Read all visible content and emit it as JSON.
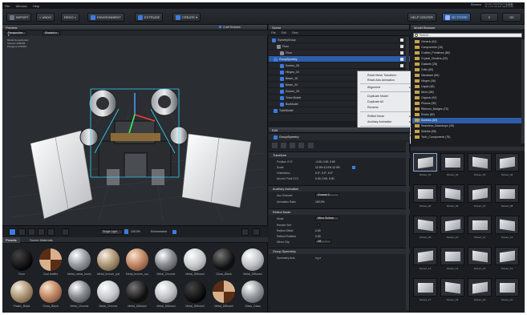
{
  "menu": [
    "File",
    "Window",
    "Help"
  ],
  "titleinfo": [
    "Quattro ENGINE/V11 2021",
    "11.1.0.0 US-EN 64bit-Vista",
    "Element",
    "1:1:5"
  ],
  "toolbar": {
    "import": "IMPORT",
    "undo": "< UNDO",
    "redo": "REDO >",
    "environment": "ENVIRONMENT",
    "extrude": "EXTRUDE",
    "create": "CREATE",
    "help": "HELP CENTER",
    "store": "3D STORE",
    "x_label": "X",
    "ok": "OK"
  },
  "viewport": {
    "title": "Preview",
    "craft": "Craft Textures",
    "view_select": "Perspective",
    "shade_select": "Shaded",
    "stats": [
      "Model  GroupSyntax",
      "Vertices  168/346",
      "Polygons  274/662"
    ],
    "light": "Single Light",
    "zoom": "100.0%",
    "env": "Environment"
  },
  "presets": {
    "tabs": [
      "Presets",
      "Scene Materials"
    ],
    "row1": [
      "Floor",
      "Cool leaftex",
      "Metal_metal_brush",
      "Metal_bronze_pat",
      "Metal_bronze_rou",
      "Metal_Chrome",
      "Metal_Diffused",
      "Gloss_Black",
      "Metal_Diffused"
    ],
    "row2": [
      "Plastic_Black",
      "Gloss_Black",
      "Metal_Chrome",
      "Metal_Chrome",
      "Metal_Diffused",
      "Metal_Diffused",
      "Metal_Diffused",
      "Metal_Diffused",
      "Glass_Glass"
    ]
  },
  "scene": {
    "title": "Scene",
    "sub": [
      "File",
      "Edit",
      "View"
    ],
    "rows": [
      "SymetryGroup",
      "Floor",
      "Floor",
      "GroupSymetry",
      "Screen_28",
      "Hinges_44",
      "Beam_16",
      "Beam_24",
      "Screen_28",
      "Torso Model",
      "BoxModel",
      "TubeModel"
    ]
  },
  "context": [
    "Reset Mesh Transform",
    "Reset Axis Animation",
    "Alignment",
    "Duplicate Model",
    "Duplicate All",
    "Rename",
    "Reflect Mode",
    "Auxiliary Animation",
    "Save as Model Preset",
    "Remove"
  ],
  "edit": {
    "title": "Edit",
    "group": "GroupSymetry",
    "transform": "Transform",
    "pos_label": "Position XYZ",
    "pos_val": "-4.00,  0.00,  0.00",
    "scale_label": "Scale",
    "scale_val": "12.0%  12.0%  12.0%",
    "orient_label": "Orientation",
    "orient_val": "0.0°,  0.0°,  0.0°",
    "anchor_label": "Anchor Point XYZ",
    "anchor_val": "0.00,  0.00,  0.00",
    "aux": "Auxiliary Animation",
    "aux_channel_label": "Aux Channel",
    "aux_channel_val": "Channel 3",
    "anim_label": "Animation Ratio",
    "anim_val": "100.0%",
    "reflect": "Reflect Mode",
    "mode_label": "Mode",
    "mode_val": "Mirror Surface",
    "render_label": "Render Self",
    "roff_label": "Reflect Offset",
    "roff_val": "0.00",
    "rrot_label": "Reflect Rotation",
    "rrot_val": "0.00",
    "mclip_label": "Mirror Clip",
    "mclip_val": "Off",
    "symm": "Group Symmetry",
    "saxis_label": "Symmetry Axis",
    "saxis_val": "x  y  z"
  },
  "browser": {
    "title": "Model Browser",
    "search_placeholder": "Search...",
    "items": [
      "Generic (61)",
      "Components (18)",
      "Crafted_Primitives (88)",
      "Crystal_Clusters (29)",
      "Gaskets (28)",
      "Grills (80)",
      "Hardware (56)",
      "Hinges (36)",
      "Liquid (48)",
      "Mech (86)",
      "Organic (92)",
      "Pistons (39)",
      "Ribbons_Badges (75)",
      "Rocks (82)",
      "Screens (80)",
      "Seamless_Backdrops (29)",
      "Shields (58)",
      "Tech_Components (76)"
    ],
    "thumbs": [
      "Screen_01",
      "Screen_02",
      "Screen_03",
      "Screen_04",
      "Screen_05",
      "Screen_06",
      "Screen_07",
      "Screen_08",
      "Screen_09",
      "Screen_10",
      "Screen_11",
      "Screen_12",
      "Screen_13",
      "Screen_14",
      "Screen_15",
      "Screen_16",
      "Screen_17",
      "Screen_18",
      "Screen_19",
      "Screen_20"
    ]
  }
}
